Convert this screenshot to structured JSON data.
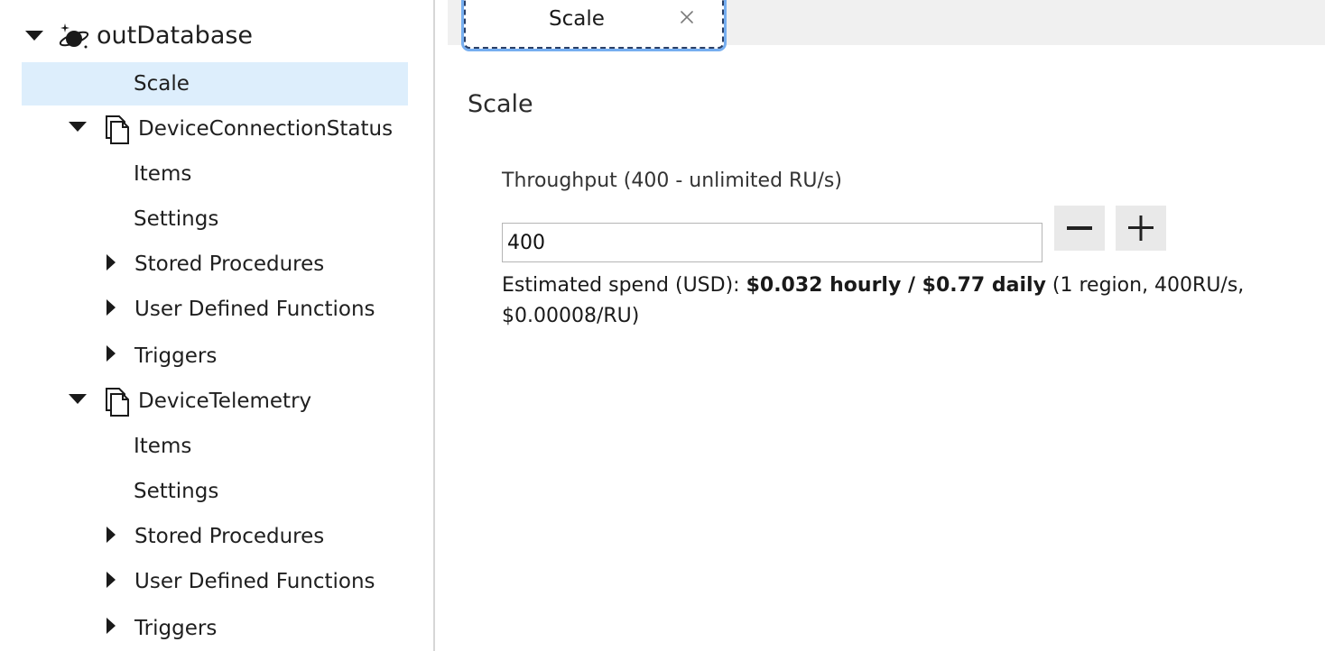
{
  "sidebar": {
    "database": {
      "label": "outDatabase",
      "icon": "cosmos-db-planet-icon"
    },
    "scale": {
      "label": "Scale"
    },
    "containers": [
      {
        "label": "DeviceConnectionStatus",
        "icon": "container-documents-icon",
        "children": {
          "items": "Items",
          "settings": "Settings",
          "stored_procedures": "Stored Procedures",
          "udfs": "User Defined Functions",
          "triggers": "Triggers"
        }
      },
      {
        "label": "DeviceTelemetry",
        "icon": "container-documents-icon",
        "children": {
          "items": "Items",
          "settings": "Settings",
          "stored_procedures": "Stored Procedures",
          "udfs": "User Defined Functions",
          "triggers": "Triggers"
        }
      }
    ]
  },
  "tab": {
    "label": "Scale",
    "close_icon": "close-icon"
  },
  "scale_panel": {
    "title": "Scale",
    "throughput_label": "Throughput (400 - unlimited RU/s)",
    "throughput_value": "400",
    "spend_prefix": "Estimated spend (USD): ",
    "spend_bold": "$0.032 hourly / $0.77 daily",
    "spend_suffix": " (1 region, 400RU/s, $0.00008/RU)"
  },
  "colors": {
    "selected_row": "#ddeefc",
    "tab_focus": "#76aef0",
    "tabstrip_bg": "#f0f0f0",
    "stepper_bg": "#e9e9e9"
  }
}
